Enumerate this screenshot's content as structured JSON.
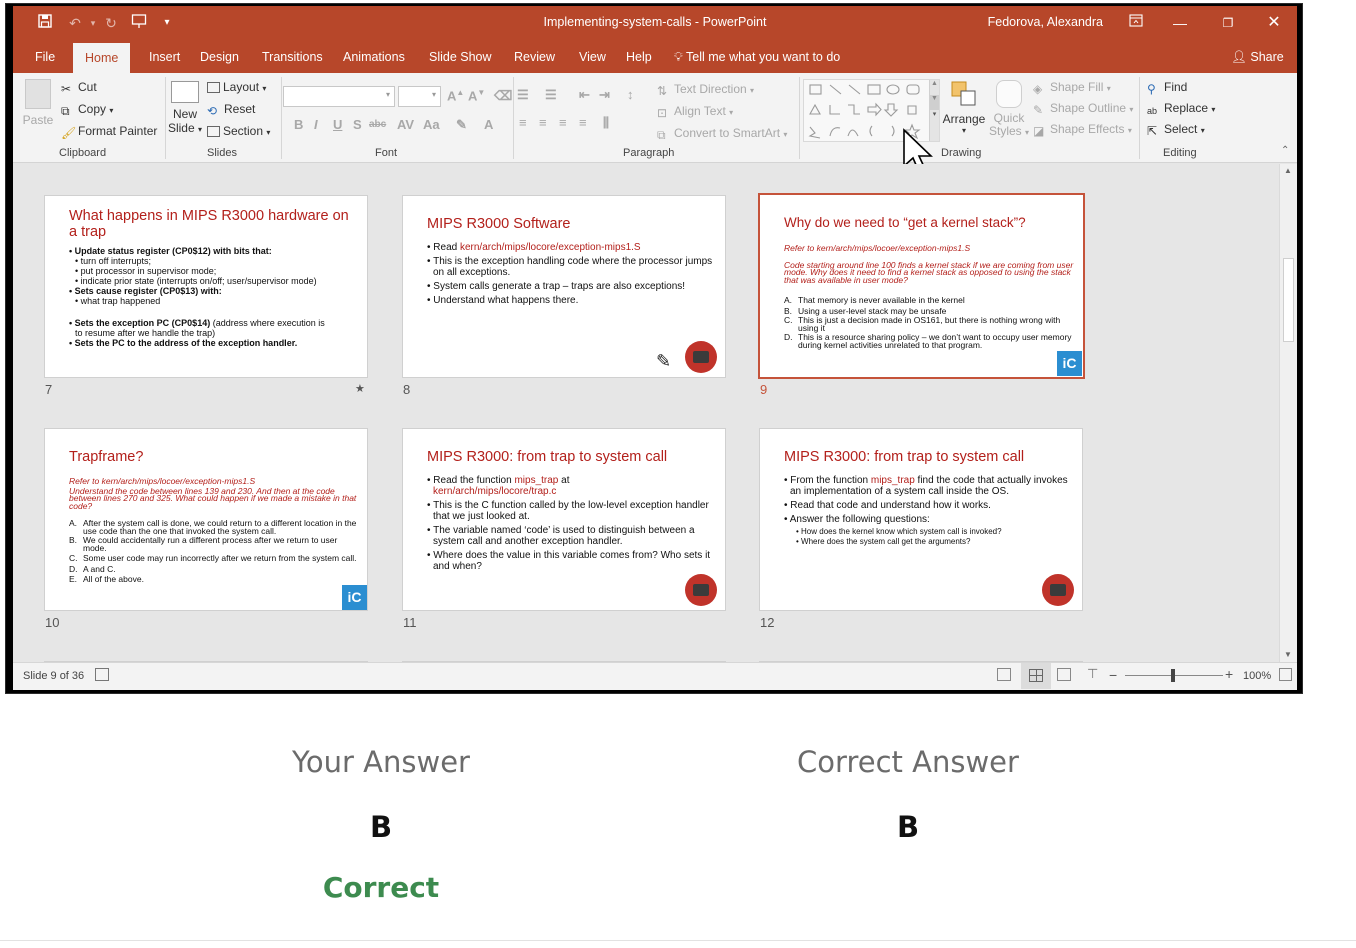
{
  "window": {
    "title": "Implementing-system-calls  -  PowerPoint",
    "user": "Fedorova, Alexandra",
    "share_label": "Share"
  },
  "tabs": [
    "File",
    "Home",
    "Insert",
    "Design",
    "Transitions",
    "Animations",
    "Slide Show",
    "Review",
    "View",
    "Help"
  ],
  "active_tab": "Home",
  "tell_me": "Tell me what you want to do",
  "ribbon": {
    "clipboard": {
      "paste": "Paste",
      "cut": "Cut",
      "copy": "Copy",
      "format_painter": "Format Painter",
      "label": "Clipboard"
    },
    "slides": {
      "new_slide_1": "New",
      "new_slide_2": "Slide",
      "layout": "Layout",
      "reset": "Reset",
      "section": "Section",
      "label": "Slides"
    },
    "font": {
      "label": "Font"
    },
    "paragraph": {
      "text_direction": "Text Direction",
      "align_text": "Align Text",
      "convert_smartart": "Convert to SmartArt",
      "label": "Paragraph"
    },
    "drawing": {
      "arrange": "Arrange",
      "quick_styles_1": "Quick",
      "quick_styles_2": "Styles",
      "shape_fill": "Shape Fill",
      "shape_outline": "Shape Outline",
      "shape_effects": "Shape Effects",
      "label": "Drawing"
    },
    "editing": {
      "find": "Find",
      "replace": "Replace",
      "select": "Select",
      "label": "Editing"
    }
  },
  "slides": [
    {
      "num": "7",
      "title": "What happens in MIPS R3000 hardware on a trap",
      "lines": [
        "• Update status register (CP0$12) with bits that:",
        "• turn off interrupts;",
        "• put processor in supervisor mode;",
        "• indicate prior state (interrupts on/off; user/supervisor mode)",
        "• Sets cause register (CP0$13) with:",
        "• what trap happened",
        "• Sets the exception PC (CP0$14)",
        " (address where execution is",
        "to resume after we handle the trap)",
        "• Sets the PC to the address of the exception handler."
      ]
    },
    {
      "num": "8",
      "title": "MIPS R3000 Software",
      "lines": [
        "• Read ",
        "kern/arch/mips/locore/exception-mips1.S",
        "• This is the exception handling code where the processor jumps on all exceptions.",
        "• System calls generate a trap – traps are also exceptions!",
        "• Understand what happens there."
      ]
    },
    {
      "num": "9",
      "title": "Why do we need to “get a kernel stack”?",
      "lines": [
        "Refer to kern/arch/mips/locoer/exception-mips1.S",
        "Code starting around line 100 finds a kernel stack if we are coming from user mode. Why does it need to find a kernel stack as opposed to using the stack that was available in user mode?",
        "A.",
        "That memory is never available in the kernel",
        "B.",
        "Using a user-level stack may be unsafe",
        "C.",
        "This is just a decision made in OS161, but there is nothing wrong with using it",
        "D.",
        "This is a resource sharing policy – we don’t want to occupy user memory during kernel activities unrelated to that program."
      ]
    },
    {
      "num": "10",
      "title": "Trapframe?",
      "lines": [
        "Refer to kern/arch/mips/locoer/exception-mips1.S",
        "Understand the code between lines 139 and 230. And then at the code between lines 270 and 325. What could happen if we made a mistake in that code?",
        "A.",
        "After the system call is done, we could return to a different location in the use code than the one that invoked the system call.",
        "B.",
        "We could accidentally run a different process after we return to user mode.",
        "C.",
        "Some user code may run incorrectly after we return from the system call.",
        "D.",
        "A and C.",
        "E.",
        "All of the above."
      ]
    },
    {
      "num": "11",
      "title": "MIPS R3000: from trap to system call",
      "lines": [
        "• Read the function ",
        "mips_trap",
        " at",
        "kern/arch/mips/locore/trap.c",
        "• This is the C function called by the low-level exception handler that we just looked at.",
        "• The variable named ‘code’ is used to distinguish between a system call and another exception handler.",
        "• Where does the value in this variable comes from? Who sets it and when?"
      ]
    },
    {
      "num": "12",
      "title": "MIPS R3000: from trap to system call",
      "lines": [
        "• From the function ",
        "mips_trap",
        " find the code that actually invokes an implementation of a system call inside the OS.",
        "• Read that code and understand how it works.",
        "• Answer the following questions:",
        "• How does the kernel know which system call is invoked?",
        "• Where does the system call get the arguments?"
      ]
    }
  ],
  "status": {
    "slide_of": "Slide 9 of 36",
    "zoom": "100%"
  },
  "quiz": {
    "your_answer_label": "Your Answer",
    "correct_answer_label": "Correct Answer",
    "your_answer": "B",
    "correct_answer": "B",
    "result": "Correct"
  },
  "colors": {
    "ppt_brand": "#b7472a",
    "slide_red": "#b3201b",
    "correct_green": "#3d8b4f"
  }
}
